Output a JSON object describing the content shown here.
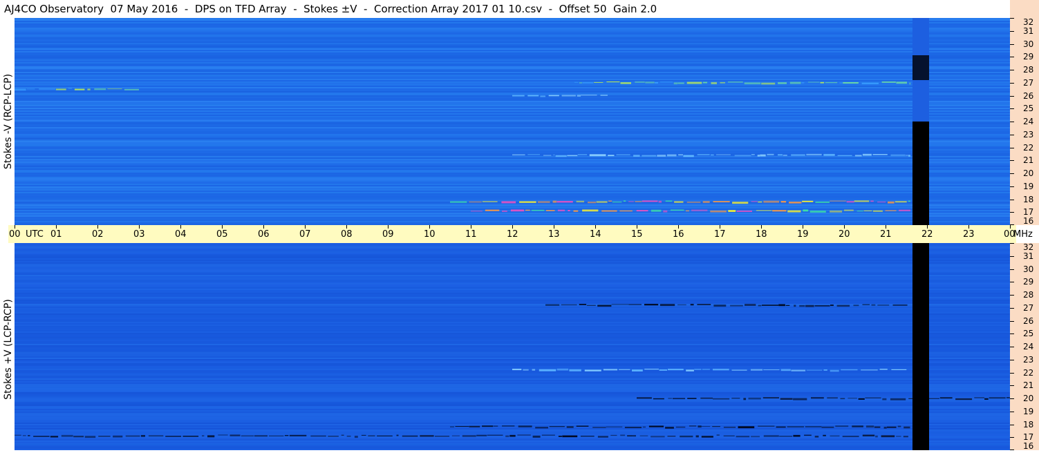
{
  "title": "AJ4CO Observatory  07 May 2016  -  DPS on TFD Array  -  Stokes ±V  -  Correction Array 2017 01 10.csv  -  Offset 50  Gain 2.0",
  "colors": {
    "background": "#1f6de8",
    "background_bottom": "#1a5fe0",
    "scale_bg": "#fbdcc4",
    "timebar_bg": "#fffbc0",
    "gap": "#000000"
  },
  "chart_data": [
    {
      "type": "heatmap",
      "panel": "top",
      "ylabel": "Stokes -V (RCP-LCP)",
      "x_axis_unit": "UTC",
      "x_ticks": [
        "00",
        "01",
        "02",
        "03",
        "04",
        "05",
        "06",
        "07",
        "08",
        "09",
        "10",
        "11",
        "12",
        "13",
        "14",
        "15",
        "16",
        "17",
        "18",
        "19",
        "20",
        "21",
        "22",
        "23",
        "00"
      ],
      "xlim_hours": [
        0,
        24
      ],
      "y_axis_unit": "MHz",
      "y_ticks": [
        "32",
        "31",
        "30",
        "29",
        "28",
        "27",
        "26",
        "25",
        "24",
        "23",
        "22",
        "21",
        "20",
        "19",
        "18",
        "17",
        "16"
      ],
      "ylim_mhz": [
        16,
        32
      ],
      "data_gap_hours": [
        21.65,
        22.05
      ],
      "features": [
        {
          "freq_mhz": 17.8,
          "start_h": 10.5,
          "end_h": 21.6,
          "level": "bright"
        },
        {
          "freq_mhz": 17.1,
          "start_h": 11.0,
          "end_h": 21.6,
          "level": "bright"
        },
        {
          "freq_mhz": 27.0,
          "start_h": 13.5,
          "end_h": 21.6,
          "level": "medium"
        },
        {
          "freq_mhz": 26.5,
          "start_h": 0.0,
          "end_h": 3.0,
          "level": "medium"
        },
        {
          "freq_mhz": 26.0,
          "start_h": 12.0,
          "end_h": 14.3,
          "level": "faint"
        },
        {
          "freq_mhz": 21.4,
          "start_h": 12.0,
          "end_h": 21.6,
          "level": "faint"
        }
      ]
    },
    {
      "type": "heatmap",
      "panel": "bottom",
      "ylabel": "Stokes +V (LCP-RCP)",
      "x_axis_unit": "UTC",
      "x_ticks": [
        "00",
        "01",
        "02",
        "03",
        "04",
        "05",
        "06",
        "07",
        "08",
        "09",
        "10",
        "11",
        "12",
        "13",
        "14",
        "15",
        "16",
        "17",
        "18",
        "19",
        "20",
        "21",
        "22",
        "23",
        "00"
      ],
      "xlim_hours": [
        0,
        24
      ],
      "y_axis_unit": "MHz",
      "y_ticks": [
        "32",
        "31",
        "30",
        "29",
        "28",
        "27",
        "26",
        "25",
        "24",
        "23",
        "22",
        "21",
        "20",
        "19",
        "18",
        "17",
        "16"
      ],
      "ylim_mhz": [
        16,
        32
      ],
      "data_gap_hours": [
        21.65,
        22.05
      ],
      "features": [
        {
          "freq_mhz": 17.8,
          "start_h": 10.5,
          "end_h": 21.6,
          "level": "dark"
        },
        {
          "freq_mhz": 17.1,
          "start_h": 0.0,
          "end_h": 21.6,
          "level": "dark"
        },
        {
          "freq_mhz": 27.2,
          "start_h": 12.8,
          "end_h": 21.6,
          "level": "dark"
        },
        {
          "freq_mhz": 22.2,
          "start_h": 12.0,
          "end_h": 21.6,
          "level": "faint"
        },
        {
          "freq_mhz": 20.0,
          "start_h": 15.0,
          "end_h": 24.0,
          "level": "dark"
        }
      ]
    }
  ]
}
